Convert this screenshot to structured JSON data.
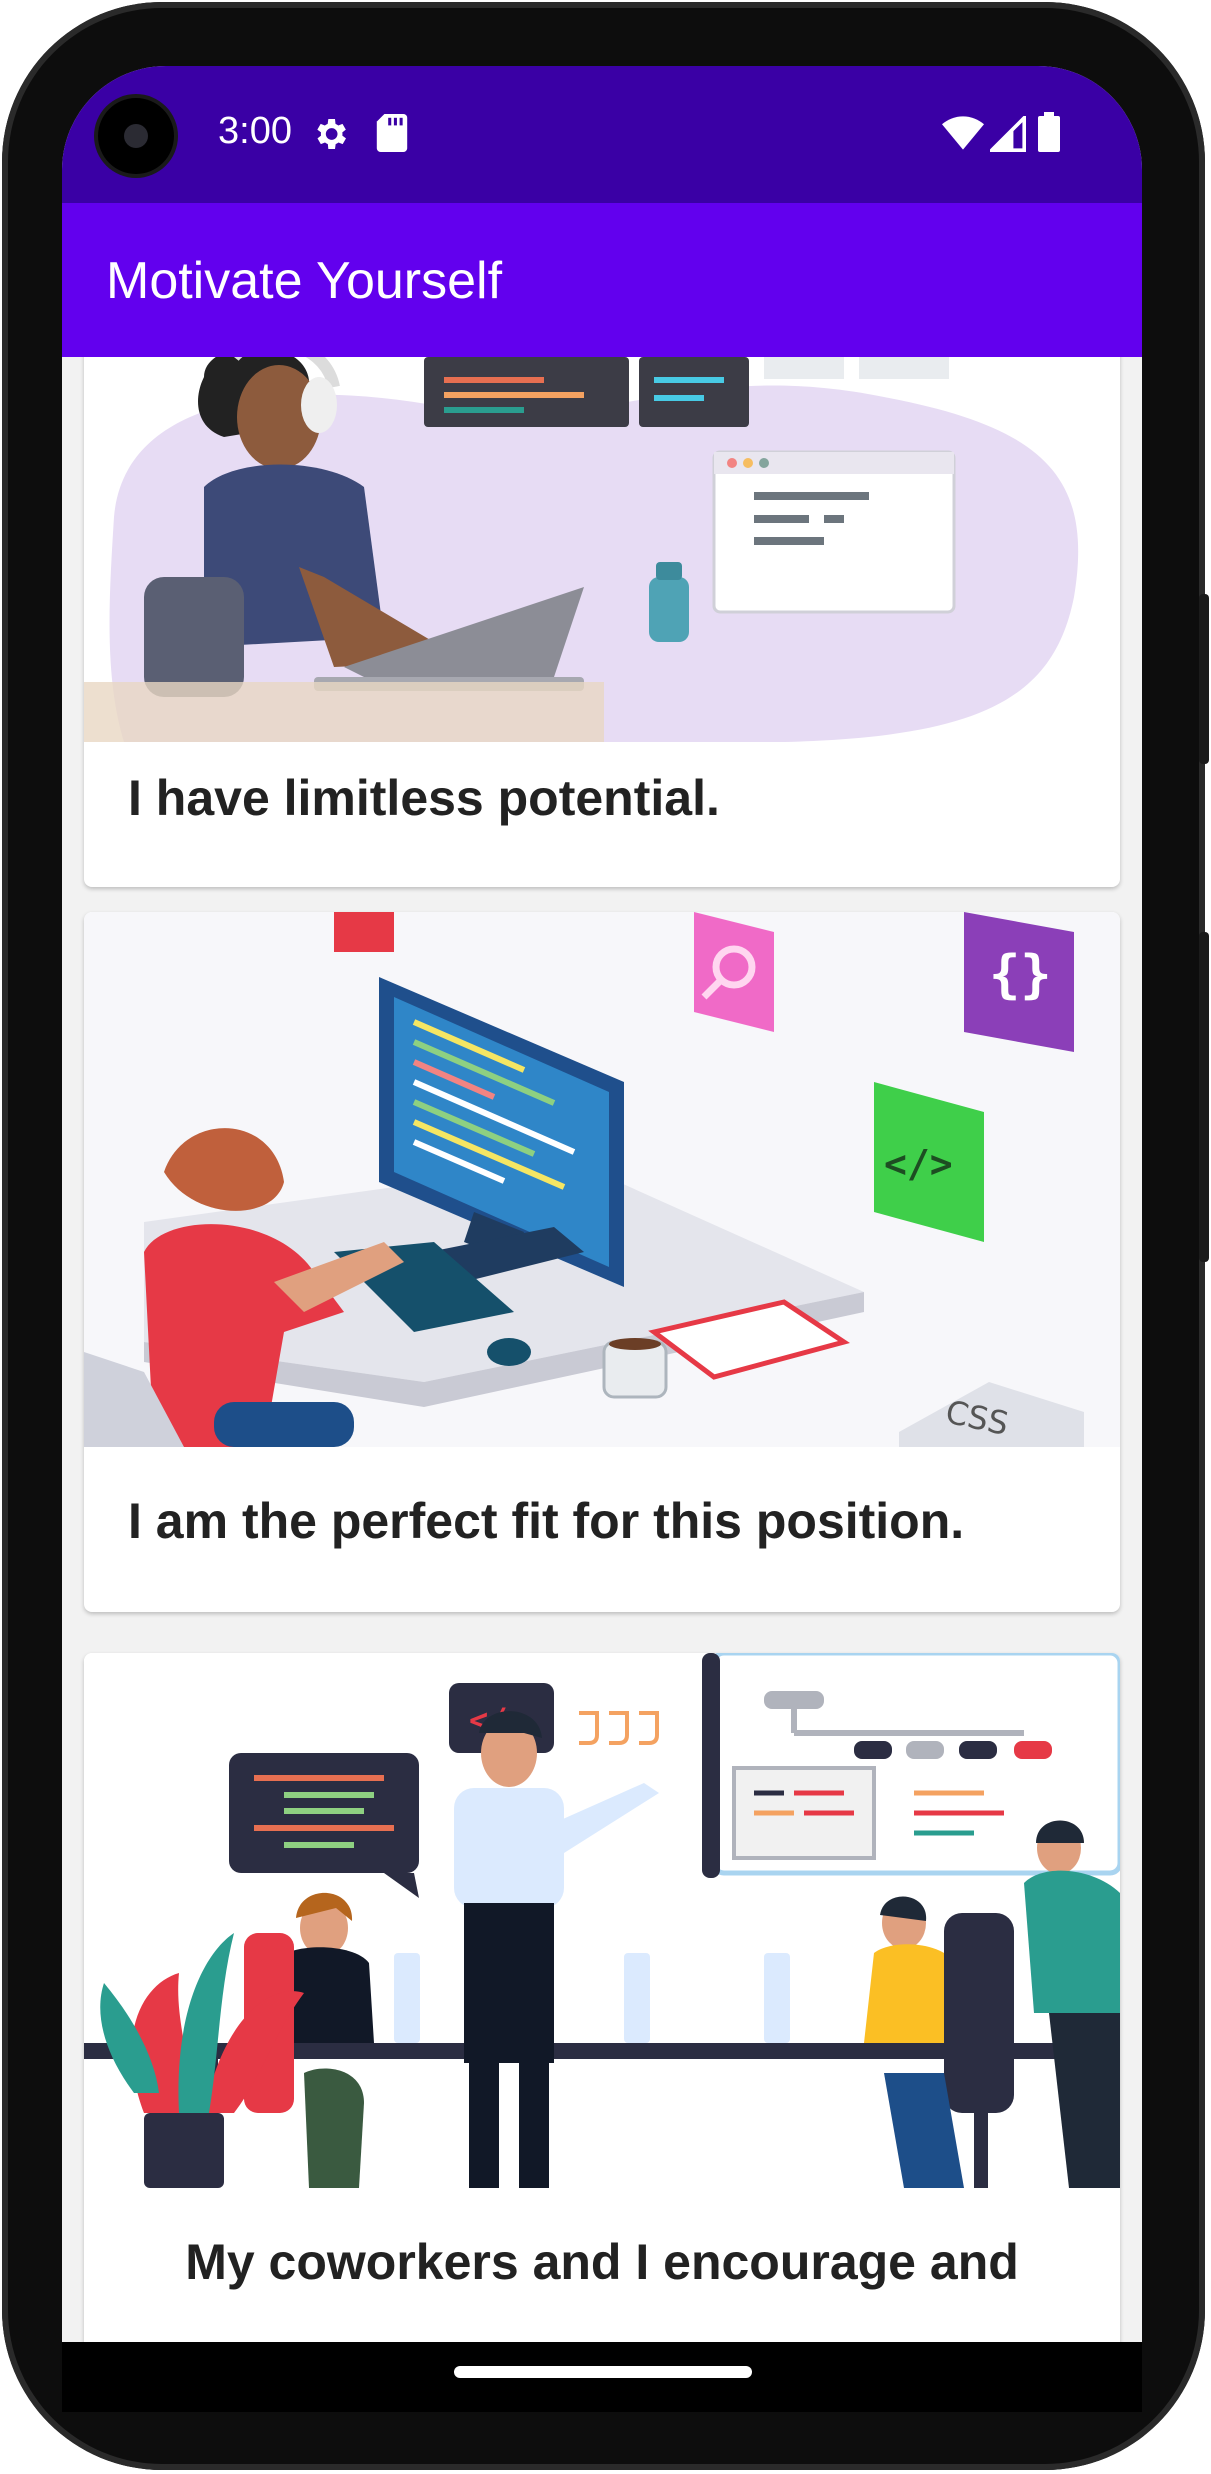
{
  "status_bar": {
    "time": "3:00",
    "icons": [
      "settings-gear-icon",
      "sd-card-icon",
      "wifi-icon",
      "cell-signal-icon",
      "battery-icon"
    ]
  },
  "app_bar": {
    "title": "Motivate Yourself",
    "color": "#6200ee",
    "status_color": "#3a00a5"
  },
  "cards": [
    {
      "text": "I have limitless potential.",
      "image": "woman-laptop-coding-illustration"
    },
    {
      "text": "I am the perfect fit for this position.",
      "image": "developer-desk-computer-illustration"
    },
    {
      "text": "My coworkers and I encourage and",
      "image": "team-meeting-office-illustration"
    }
  ]
}
